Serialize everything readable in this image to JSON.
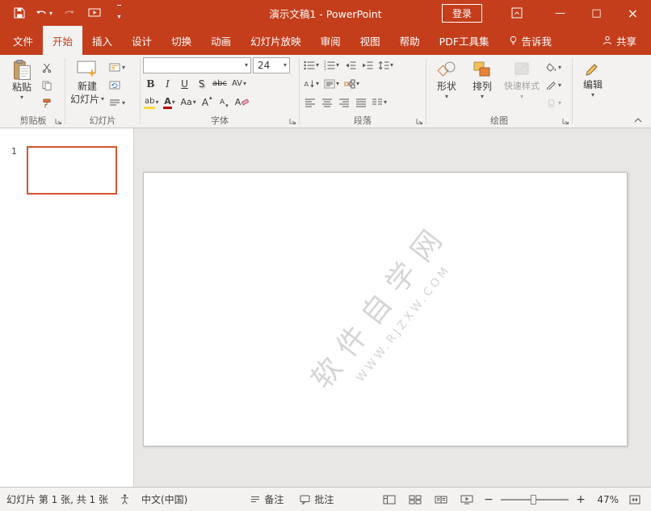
{
  "colors": {
    "accent": "#C43E1C",
    "thumbnail_selected_border": "#D6542E",
    "watermark": "#D7D5D3",
    "font_color_swatch": "#C00000",
    "highlight_swatch": "#F7D843"
  },
  "icons": {
    "chevron_down": "▾",
    "minimize": "—",
    "maximize": "□",
    "close": "×",
    "zoom_out": "−",
    "zoom_in": "+"
  },
  "titlebar": {
    "title": "演示文稿1 - PowerPoint",
    "signin_label": "登录"
  },
  "tabs": {
    "items": [
      {
        "label": "文件"
      },
      {
        "label": "开始"
      },
      {
        "label": "插入"
      },
      {
        "label": "设计"
      },
      {
        "label": "切换"
      },
      {
        "label": "动画"
      },
      {
        "label": "幻灯片放映"
      },
      {
        "label": "审阅"
      },
      {
        "label": "视图"
      },
      {
        "label": "帮助"
      },
      {
        "label": "PDF工具集"
      },
      {
        "label": "告诉我"
      },
      {
        "label": "共享"
      }
    ]
  },
  "ribbon": {
    "clipboard": {
      "paste_label": "粘贴",
      "group_label": "剪贴板"
    },
    "slides": {
      "new_slide_line1": "新建",
      "new_slide_line2": "幻灯片",
      "group_label": "幻灯片"
    },
    "font": {
      "font_size_value": "24",
      "bold_label": "B",
      "italic_label": "I",
      "underline_label": "U",
      "shadow_label": "S",
      "strikethrough_label": "abc",
      "spacing_label": "AV",
      "highlight_label": "ab",
      "color_label": "A",
      "case_label": "Aa",
      "grow_label": "A",
      "shrink_label": "A",
      "clear_label": "A",
      "group_label": "字体"
    },
    "paragraph": {
      "group_label": "段落"
    },
    "drawing": {
      "shapes_label": "形状",
      "arrange_label": "排列",
      "quick_styles_label": "快速样式",
      "group_label": "绘图"
    },
    "editing": {
      "editing_label": "编辑"
    }
  },
  "slides_panel": {
    "slide_number": "1"
  },
  "canvas": {
    "watermark_line1": "软件自学网",
    "watermark_line2": "WWW.RJZXW.COM"
  },
  "statusbar": {
    "slide_info": "幻灯片 第 1 张, 共 1 张",
    "language": "中文(中国)",
    "notes_label": "备注",
    "comments_label": "批注",
    "zoom_value": "47%"
  }
}
